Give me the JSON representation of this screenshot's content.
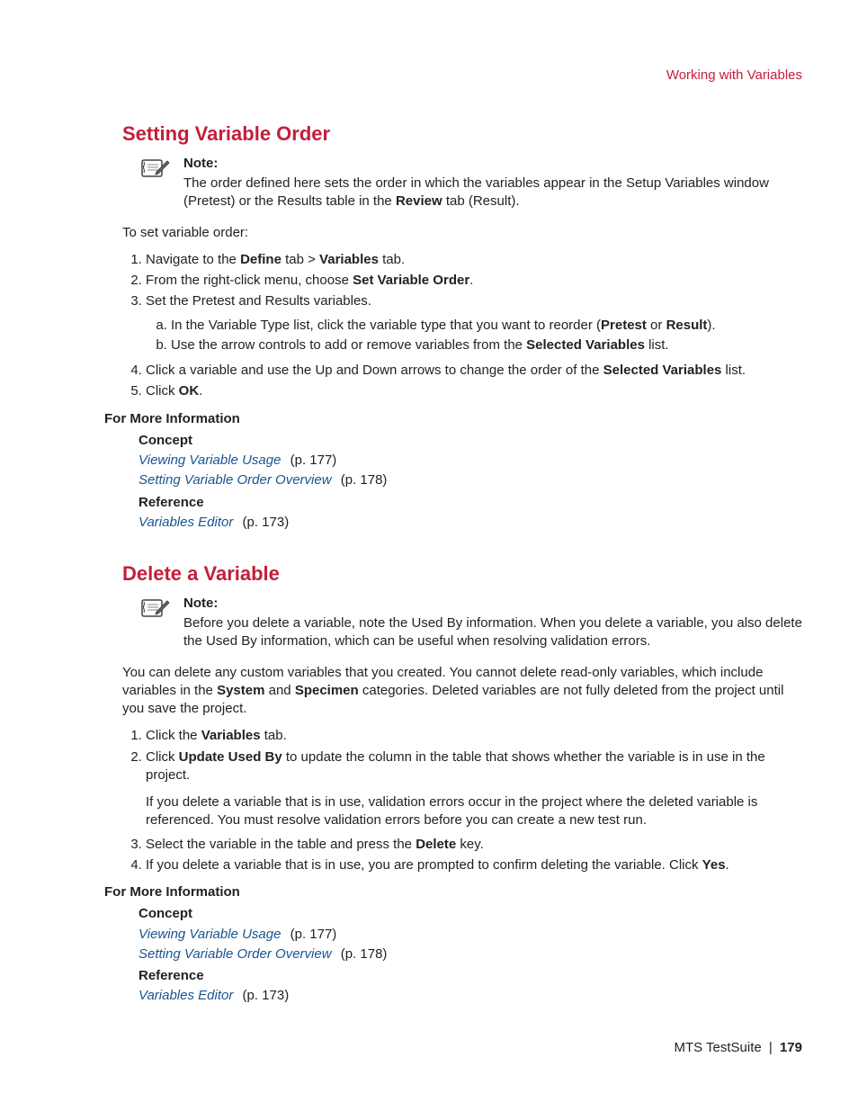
{
  "header": {
    "chapter": "Working with Variables"
  },
  "section1": {
    "title": "Setting Variable Order",
    "noteLabel": "Note:",
    "noteBody_1": "The order defined here sets the order in which the variables appear in the Setup Variables window (Pretest) or the Results table in the ",
    "noteBody_reviewBold": "Review",
    "noteBody_2": " tab (Result).",
    "lead": "To set variable order:",
    "s1_a": "Navigate to the ",
    "s1_define": "Define",
    "s1_b": " tab > ",
    "s1_variables": "Variables",
    "s1_c": " tab.",
    "s2_a": "From the right-click menu, choose ",
    "s2_b": "Set Variable Order",
    "s2_c": ".",
    "s3": "Set the Pretest and Results variables.",
    "s3a_a": "In the Variable Type list, click the variable type that you want to reorder (",
    "s3a_pretest": "Pretest",
    "s3a_or": " or ",
    "s3a_result": "Result",
    "s3a_b": ").",
    "s3b_a": "Use the arrow controls to add or remove variables from the ",
    "s3b_sel": "Selected Variables",
    "s3b_b": " list.",
    "s4_a": "Click a variable and use the Up and Down arrows to change the order of the ",
    "s4_sel": "Selected Variables",
    "s4_b": " list.",
    "s5_a": "Click ",
    "s5_ok": "OK",
    "s5_b": "."
  },
  "fmi": {
    "heading": "For More Information",
    "concept": "Concept",
    "reference": "Reference",
    "link1": "Viewing Variable Usage",
    "pg1": " (p. 177)",
    "link2": "Setting Variable Order Overview",
    "pg2": " (p. 178)",
    "link3": "Variables Editor",
    "pg3": " (p. 173)"
  },
  "section2": {
    "title": "Delete a Variable",
    "noteLabel": "Note:",
    "noteBody": "Before you delete a variable, note the Used By information. When you delete a variable, you also delete the Used By information, which can be useful when resolving validation errors.",
    "para_a": "You can delete any custom variables that you created. You cannot delete read-only variables, which include variables in the ",
    "para_system": "System",
    "para_and": " and ",
    "para_specimen": "Specimen",
    "para_b": " categories. Deleted variables are not fully deleted from the project until you save the project.",
    "s1_a": "Click the ",
    "s1_variables": "Variables",
    "s1_b": " tab.",
    "s2_a": "Click ",
    "s2_upd": "Update Used By",
    "s2_b": " to update the column in the table that shows whether the variable is in use in the project.",
    "s2_extra": "If you delete a variable that is in use, validation errors occur in the project where the deleted variable is referenced. You must resolve validation errors before you can create a new test run.",
    "s3_a": "Select the variable in the table and press the ",
    "s3_del": "Delete",
    "s3_b": " key.",
    "s4_a": "If you delete a variable that is in use, you are prompted to confirm deleting the variable. Click ",
    "s4_yes": "Yes",
    "s4_b": "."
  },
  "footer": {
    "product": "MTS TestSuite",
    "sep": " | ",
    "page": "179"
  }
}
